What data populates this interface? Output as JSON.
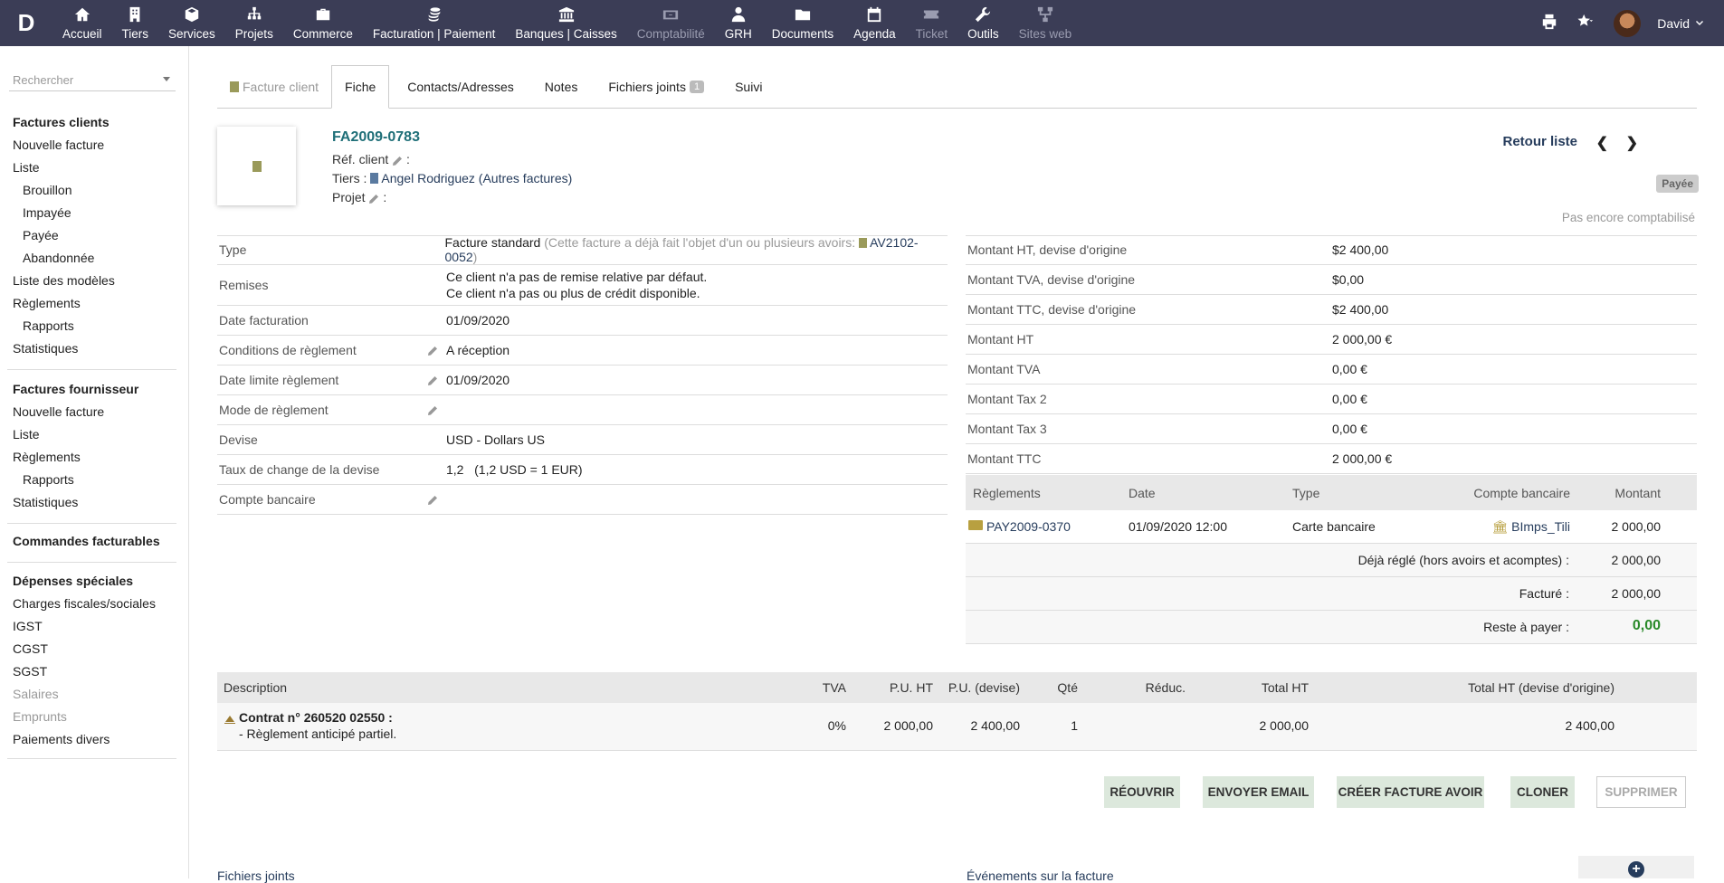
{
  "topbar": {
    "logo": "D",
    "menu": [
      {
        "label": "Accueil",
        "icon": "home-icon",
        "dim": false
      },
      {
        "label": "Tiers",
        "icon": "building-icon",
        "dim": false
      },
      {
        "label": "Services",
        "icon": "cube-icon",
        "dim": false
      },
      {
        "label": "Projets",
        "icon": "sitemap-icon",
        "dim": false
      },
      {
        "label": "Commerce",
        "icon": "briefcase-icon",
        "dim": false
      },
      {
        "label": "Facturation | Paiement",
        "icon": "coins-icon",
        "dim": false
      },
      {
        "label": "Banques | Caisses",
        "icon": "bank-icon",
        "dim": false
      },
      {
        "label": "Comptabilité",
        "icon": "money-icon",
        "dim": true
      },
      {
        "label": "GRH",
        "icon": "user-tie-icon",
        "dim": false
      },
      {
        "label": "Documents",
        "icon": "folder-icon",
        "dim": false
      },
      {
        "label": "Agenda",
        "icon": "calendar-icon",
        "dim": false
      },
      {
        "label": "Ticket",
        "icon": "ticket-icon",
        "dim": true
      },
      {
        "label": "Outils",
        "icon": "wrench-icon",
        "dim": false
      },
      {
        "label": "Sites web",
        "icon": "network-icon",
        "dim": true
      }
    ],
    "user": "David"
  },
  "sidebar": {
    "search_placeholder": "Rechercher",
    "group1": {
      "title": "Factures clients",
      "items": [
        "Nouvelle facture",
        "Liste",
        "Brouillon",
        "Impayée",
        "Payée",
        "Abandonnée",
        "Liste des modèles",
        "Règlements",
        "Rapports",
        "Statistiques"
      ]
    },
    "group2": {
      "title": "Factures fournisseur",
      "items": [
        "Nouvelle facture",
        "Liste",
        "Règlements",
        "Rapports",
        "Statistiques"
      ]
    },
    "group3": {
      "title": "Commandes facturables"
    },
    "group4": {
      "title": "Dépenses spéciales",
      "items": [
        "Charges fiscales/sociales",
        "IGST",
        "CGST",
        "SGST",
        "Salaires",
        "Emprunts",
        "Paiements divers"
      ]
    }
  },
  "tabs": {
    "t0": "Facture client",
    "t1": "Fiche",
    "t2": "Contacts/Adresses",
    "t3": "Notes",
    "t4": "Fichiers joints",
    "t4_badge": "1",
    "t5": "Suivi"
  },
  "invoice": {
    "ref": "FA2009-0783",
    "ref_client_label": "Réf. client",
    "tiers_label": "Tiers :",
    "tiers_value": "Angel Rodriguez",
    "tiers_other": "(Autres factures)",
    "projet_label": "Projet",
    "retour": "Retour liste",
    "status": "Payée",
    "compta": "Pas encore comptabilisé"
  },
  "fields": {
    "type_label": "Type",
    "type_value": "Facture standard",
    "type_note": "(Cette facture a déjà fait l'objet d'un ou plusieurs avoirs:",
    "type_link": "AV2102-0052",
    "type_close": ")",
    "remises_label": "Remises",
    "remises_line1": "Ce client n'a pas de remise relative par défaut.",
    "remises_line2": "Ce client n'a pas ou plus de crédit disponible.",
    "date_fact_label": "Date facturation",
    "date_fact_value": "01/09/2020",
    "cond_label": "Conditions de règlement",
    "cond_value": "A réception",
    "date_lim_label": "Date limite règlement",
    "date_lim_value": "01/09/2020",
    "mode_label": "Mode de règlement",
    "devise_label": "Devise",
    "devise_value": "USD - Dollars US",
    "taux_label": "Taux de change de la devise",
    "taux_value": "1,2",
    "taux_note": "(1,2 USD = 1 EUR)",
    "compte_label": "Compte bancaire"
  },
  "amounts": [
    {
      "label": "Montant HT, devise d'origine",
      "value": "$2 400,00"
    },
    {
      "label": "Montant TVA, devise d'origine",
      "value": "$0,00"
    },
    {
      "label": "Montant TTC, devise d'origine",
      "value": "$2 400,00"
    },
    {
      "label": "Montant HT",
      "value": "2 000,00 €"
    },
    {
      "label": "Montant TVA",
      "value": "0,00 €"
    },
    {
      "label": "Montant Tax 2",
      "value": "0,00 €"
    },
    {
      "label": "Montant Tax 3",
      "value": "0,00 €"
    },
    {
      "label": "Montant TTC",
      "value": "2 000,00 €"
    }
  ],
  "payments": {
    "head": {
      "reglements": "Règlements",
      "date": "Date",
      "type": "Type",
      "compte": "Compte bancaire",
      "montant": "Montant"
    },
    "row": {
      "ref": "PAY2009-0370",
      "date": "01/09/2020 12:00",
      "type": "Carte bancaire",
      "compte": "BImps_Tili",
      "montant": "2 000,00"
    },
    "deja_label": "Déjà réglé (hors avoirs et acomptes) :",
    "deja_value": "2 000,00",
    "facture_label": "Facturé :",
    "facture_value": "2 000,00",
    "reste_label": "Reste à payer :",
    "reste_value": "0,00",
    "reste_color": "#2a8a2a"
  },
  "lines": {
    "head": {
      "desc": "Description",
      "tva": "TVA",
      "pu": "P.U. HT",
      "pud": "P.U. (devise)",
      "qte": "Qté",
      "reduc": "Réduc.",
      "total": "Total HT",
      "totald": "Total HT (devise d'origine)"
    },
    "row": {
      "title": "Contrat n° 260520 02550 :",
      "sub": "- Règlement anticipé partiel.",
      "tva": "0%",
      "pu": "2 000,00",
      "pud": "2 400,00",
      "qte": "1",
      "total": "2 000,00",
      "totald": "2 400,00"
    }
  },
  "actions": {
    "reopen": "RÉOUVRIR",
    "email": "ENVOYER EMAIL",
    "avoir": "CRÉER FACTURE AVOIR",
    "clone": "CLONER",
    "delete": "SUPPRIMER"
  },
  "bottom": {
    "files": "Fichiers joints",
    "events": "Événements sur la facture"
  }
}
